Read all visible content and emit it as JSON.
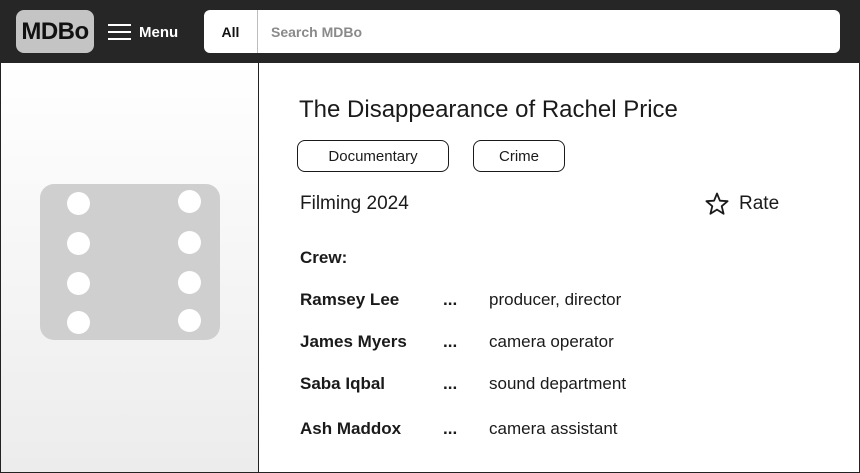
{
  "header": {
    "logo": "MDBo",
    "menu_label": "Menu",
    "search_category": "All",
    "search_placeholder": "Search MDBo",
    "search_value": ""
  },
  "poster": {
    "icon": "film-strip-icon"
  },
  "title": {
    "name": "The Disappearance of Rachel Price",
    "genres": [
      "Documentary",
      "Crime"
    ],
    "status": "Filming 2024",
    "rate_label": "Rate",
    "rate_icon": "star-outline-icon"
  },
  "crew": {
    "heading": "Crew:",
    "members": [
      {
        "name": "Ramsey Lee",
        "separator": "...",
        "role": "producer, director"
      },
      {
        "name": "James Myers",
        "separator": "...",
        "role": "camera operator"
      },
      {
        "name": "Saba Iqbal",
        "separator": "...",
        "role": "sound department"
      },
      {
        "name": "Ash Maddox",
        "separator": "...",
        "role": "camera assistant"
      }
    ]
  },
  "colors": {
    "topbar": "#262626",
    "logo_bg": "#c4c4c4",
    "placeholder_bg": "#cfcfcf"
  }
}
